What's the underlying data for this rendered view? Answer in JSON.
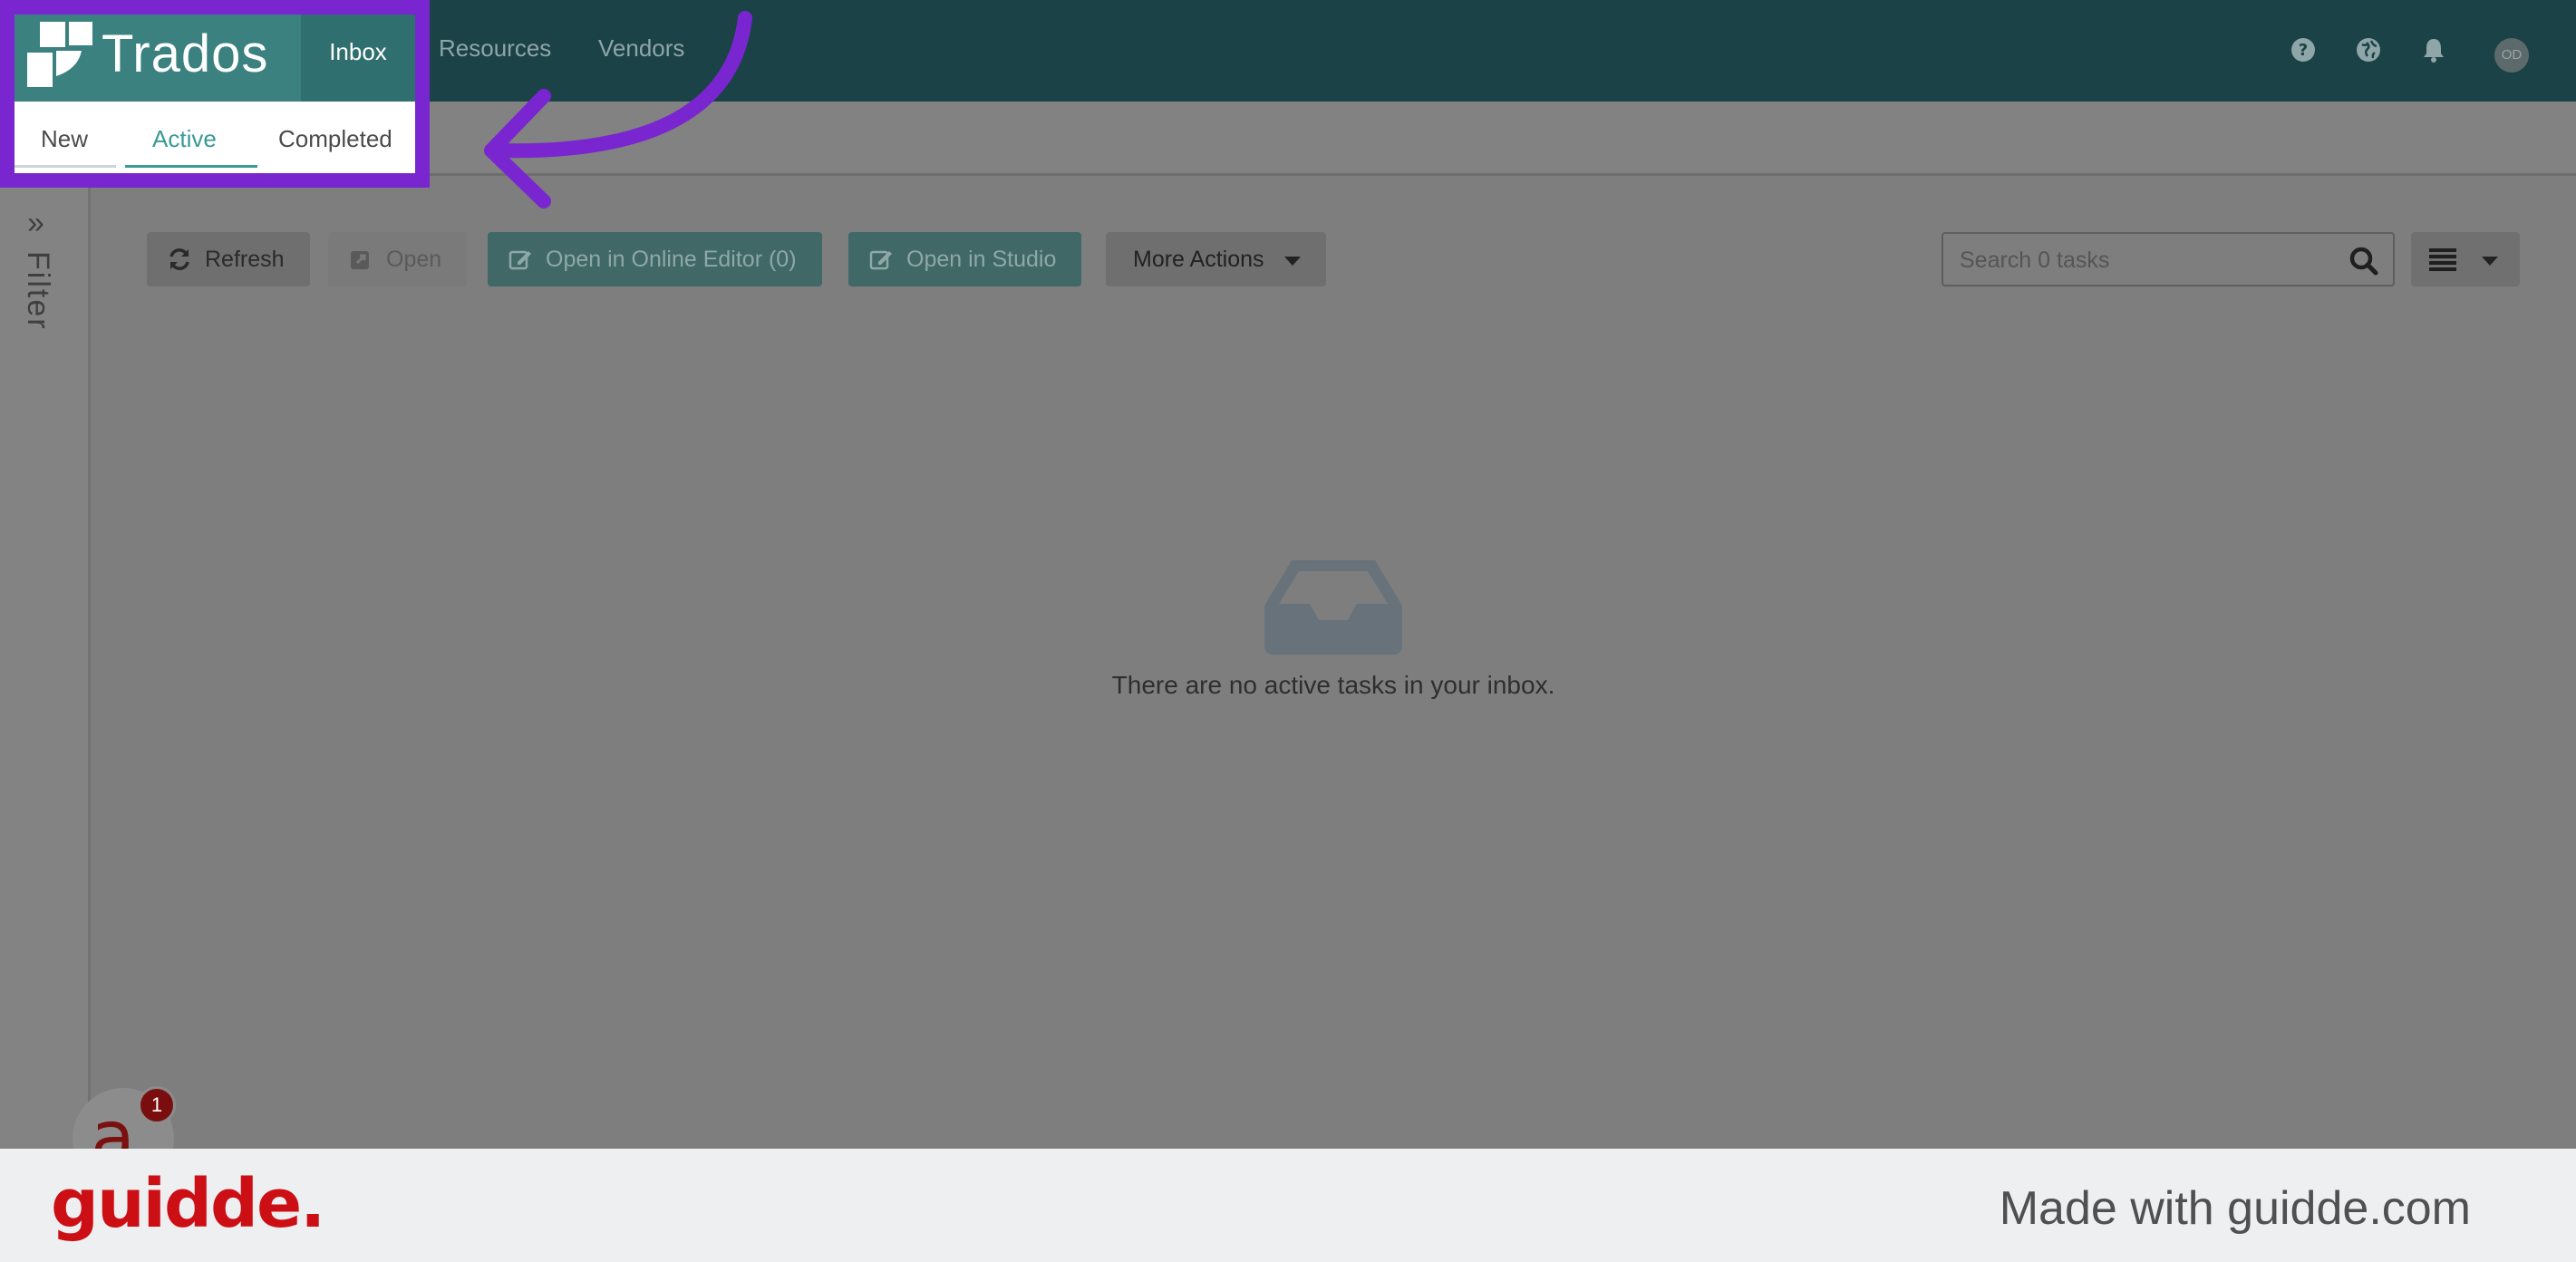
{
  "app": {
    "logo_text": "Trados",
    "nav": {
      "inbox": "Inbox",
      "resources": "Resources",
      "vendors": "Vendors"
    },
    "user_initials": "OD"
  },
  "subtabs": {
    "new": "New",
    "active": "Active",
    "completed": "Completed"
  },
  "sidebar": {
    "filter_label": "Filter",
    "expand_glyph": "»"
  },
  "toolbar": {
    "refresh": "Refresh",
    "open": "Open",
    "open_online_editor": "Open in Online Editor (0)",
    "open_studio": "Open in Studio",
    "more_actions": "More Actions"
  },
  "search": {
    "placeholder": "Search 0 tasks"
  },
  "empty_state": {
    "message": "There are no active tasks in your inbox."
  },
  "widget": {
    "badge_count": "1",
    "glyph": "a"
  },
  "footer": {
    "brand": "guidde.",
    "made_with": "Made with guidde.com"
  },
  "colors": {
    "highlight": "#7a26d0",
    "teal": "#3a8180",
    "topbar": "#1b4246",
    "brand_red": "#cc0f14"
  }
}
